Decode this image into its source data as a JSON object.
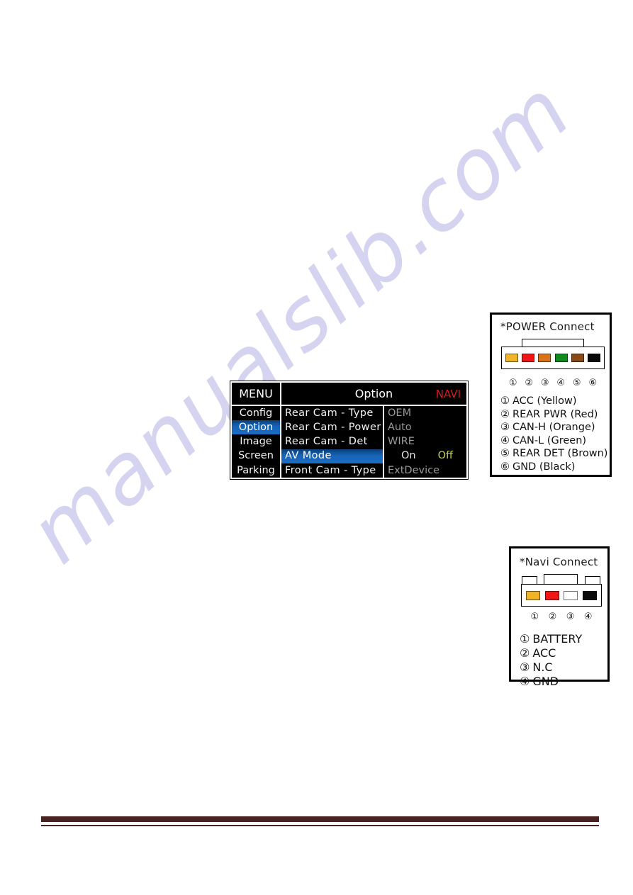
{
  "watermark": {
    "text": "manualslib.com",
    "color": "#d3d2f0"
  },
  "osd_menu": {
    "header": {
      "menu_label": "MENU",
      "title": "Option",
      "mode": "NAVI",
      "mode_color": "#e01b1b"
    },
    "left_column": [
      {
        "label": "Config",
        "selected": false
      },
      {
        "label": "Option",
        "selected": true
      },
      {
        "label": "Image",
        "selected": false
      },
      {
        "label": "Screen",
        "selected": false
      },
      {
        "label": "Parking",
        "selected": false
      }
    ],
    "middle_column": [
      {
        "label": "Rear Cam - Type",
        "selected": false
      },
      {
        "label": "Rear Cam - Power",
        "selected": false
      },
      {
        "label": "Rear Cam - Det",
        "selected": false
      },
      {
        "label": "AV Mode",
        "selected": true
      },
      {
        "label": "Front Cam - Type",
        "selected": false
      }
    ],
    "right_column": [
      {
        "label": "OEM"
      },
      {
        "label": "Auto"
      },
      {
        "label": "WIRE"
      },
      {
        "on_label": "On",
        "off_label": "Off",
        "off_color": "#c6d63c"
      },
      {
        "label": "ExtDevice"
      }
    ],
    "highlight_color": "#1664b8"
  },
  "power_connect": {
    "title": "*POWER Connect",
    "pins": [
      {
        "num": "①",
        "color": "#f0b429"
      },
      {
        "num": "②",
        "color": "#f21515"
      },
      {
        "num": "③",
        "color": "#d9741a"
      },
      {
        "num": "④",
        "color": "#0f8a1e"
      },
      {
        "num": "⑤",
        "color": "#8a4a17"
      },
      {
        "num": "⑥",
        "color": "#0a0a0a"
      }
    ],
    "pin_numbers": [
      "①",
      "②",
      "③",
      "④",
      "⑤",
      "⑥"
    ],
    "legend": [
      {
        "num": "①",
        "text": "ACC (Yellow)"
      },
      {
        "num": "②",
        "text": "REAR PWR (Red)"
      },
      {
        "num": "③",
        "text": "CAN-H (Orange)"
      },
      {
        "num": "④",
        "text": "CAN-L (Green)"
      },
      {
        "num": "⑤",
        "text": "REAR DET (Brown)"
      },
      {
        "num": "⑥",
        "text": "GND (Black)"
      }
    ]
  },
  "navi_connect": {
    "title": "*Navi Connect",
    "pins": [
      {
        "num": "①",
        "color": "#f0b429"
      },
      {
        "num": "②",
        "color": "#f21515"
      },
      {
        "num": "③",
        "color": "#ffffff"
      },
      {
        "num": "④",
        "color": "#0a0a0a"
      }
    ],
    "pin_numbers": [
      "①",
      "②",
      "③",
      "④"
    ],
    "legend": [
      {
        "num": "①",
        "text": "BATTERY"
      },
      {
        "num": "②",
        "text": "ACC"
      },
      {
        "num": "③",
        "text": "N.C"
      },
      {
        "num": "④",
        "text": "GND"
      }
    ]
  },
  "footer": {
    "rule_color": "#4a2222"
  }
}
